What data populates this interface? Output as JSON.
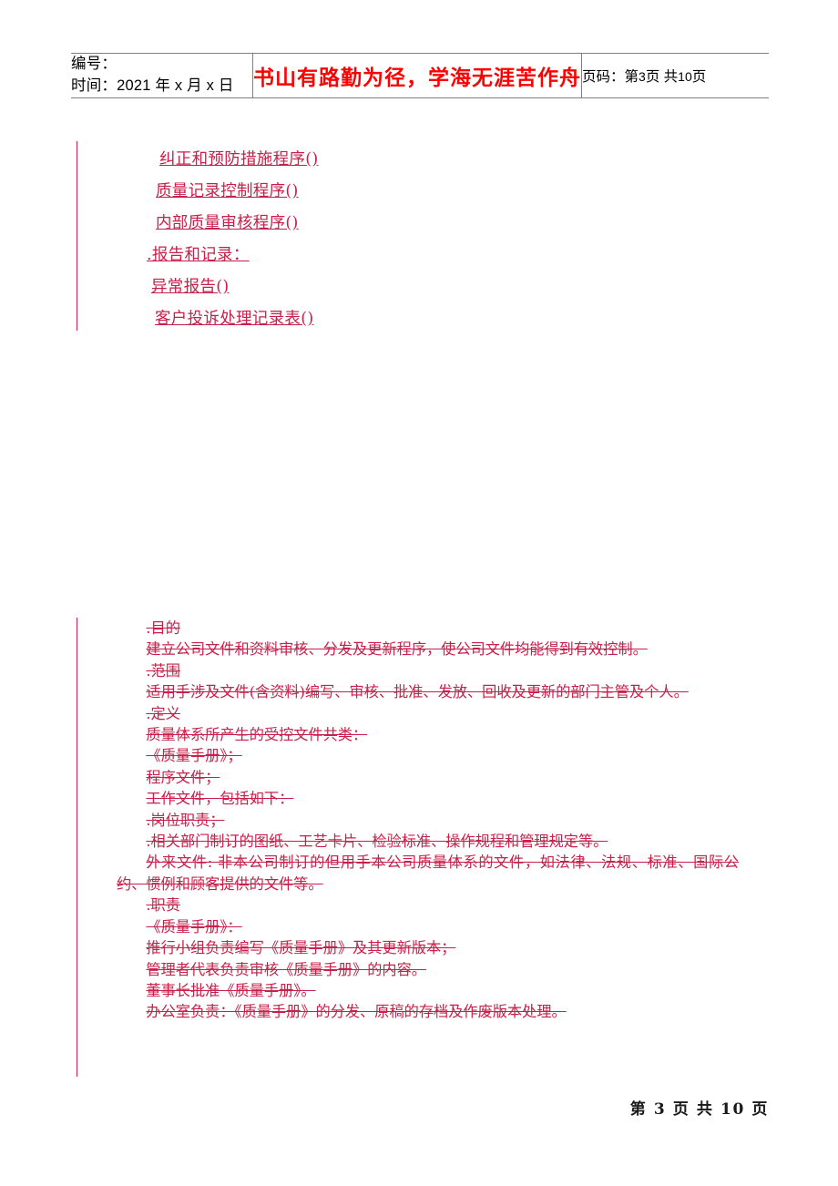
{
  "header": {
    "doc_number_label": "编号：",
    "doc_number_value": "",
    "time_label": "时间：",
    "time_value": "2021 年 x 月 x 日",
    "motto": "书山有路勤为径，学海无涯苦作舟",
    "page_label": "页码：",
    "page_current_prefix": "第",
    "page_current": "3",
    "page_unit": "页",
    "page_total_prefix": "共",
    "page_total": "10",
    "page_total_unit": "页"
  },
  "links": [
    {
      "text": "纠正和预防措施程序()"
    },
    {
      "text": "质量记录控制程序()"
    },
    {
      "text": "内部质量审核程序()"
    },
    {
      "text": ".报告和记录："
    },
    {
      "text": "异常报告()"
    },
    {
      "text": "客户投诉处理记录表()"
    }
  ],
  "body": {
    "paragraphs": [
      ".目的",
      "建立公司文件和资料审核、分发及更新程序，使公司文件均能得到有效控制。",
      ".范围",
      "适用手涉及文件(含资料)编写、审核、批准、发放、回收及更新的部门主管及个人。",
      ".定义",
      "质量体系所产生的受控文件共类：",
      "《质量手册》；",
      "程序文件；",
      "工作文件，包括如下：",
      ".岗位职责；",
      ".相关部门制订的图纸、工艺卡片、检验标准、操作规程和管理规定等。",
      "外来文件: 非本公司制订的但用手本公司质量体系的文件，如法律、法规、标准、国际公约、惯例和顾客提供的文件等。",
      ".职责",
      "《质量手册》：",
      "推行小组负责编写《质量手册》及其更新版本；",
      "管理者代表负责审核《质量手册》的内容。",
      "董事长批准《质量手册》。",
      "办公室负责：《质量手册》的分发、原稿的存档及作废版本处理。"
    ]
  },
  "footer": {
    "text": "第 3 页 共 10 页"
  },
  "colors": {
    "revision_red": "#c8204a",
    "motto_red": "#ff0000",
    "rule_gray": "#808080"
  }
}
